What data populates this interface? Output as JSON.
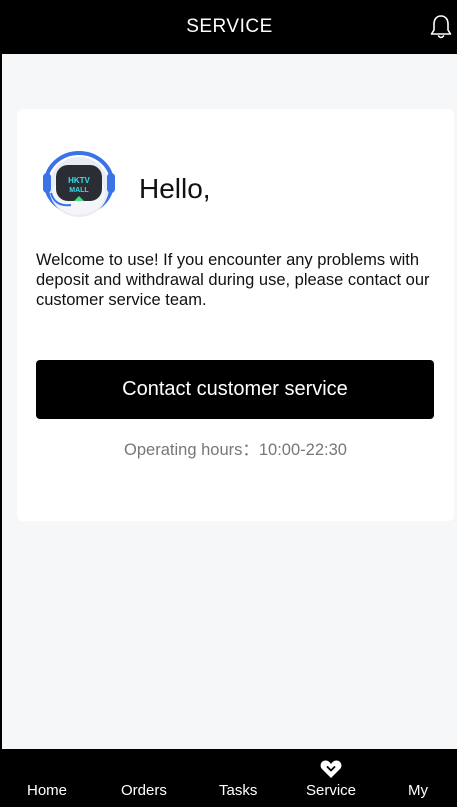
{
  "header": {
    "title": "SERVICE",
    "bell_icon": "bell-icon"
  },
  "card": {
    "avatar_icon": "robot-avatar-icon",
    "avatar_text_line1": "HKTV",
    "avatar_text_line2": "MALL",
    "greeting": "Hello,",
    "description": "Welcome to use! If you encounter any problems with deposit and withdrawal during use, please contact our customer service team.",
    "contact_button_label": "Contact customer service",
    "operating_hours": "Operating hours：10:00-22:30"
  },
  "nav": {
    "items": [
      {
        "label": "Home"
      },
      {
        "label": "Orders"
      },
      {
        "label": "Tasks"
      },
      {
        "label": "Service"
      },
      {
        "label": "My"
      }
    ],
    "active_icon": "service-heart-icon"
  },
  "colors": {
    "bar_background": "#000000",
    "page_background": "#f6f7f9",
    "card_background": "#ffffff",
    "muted_text": "#777777"
  }
}
